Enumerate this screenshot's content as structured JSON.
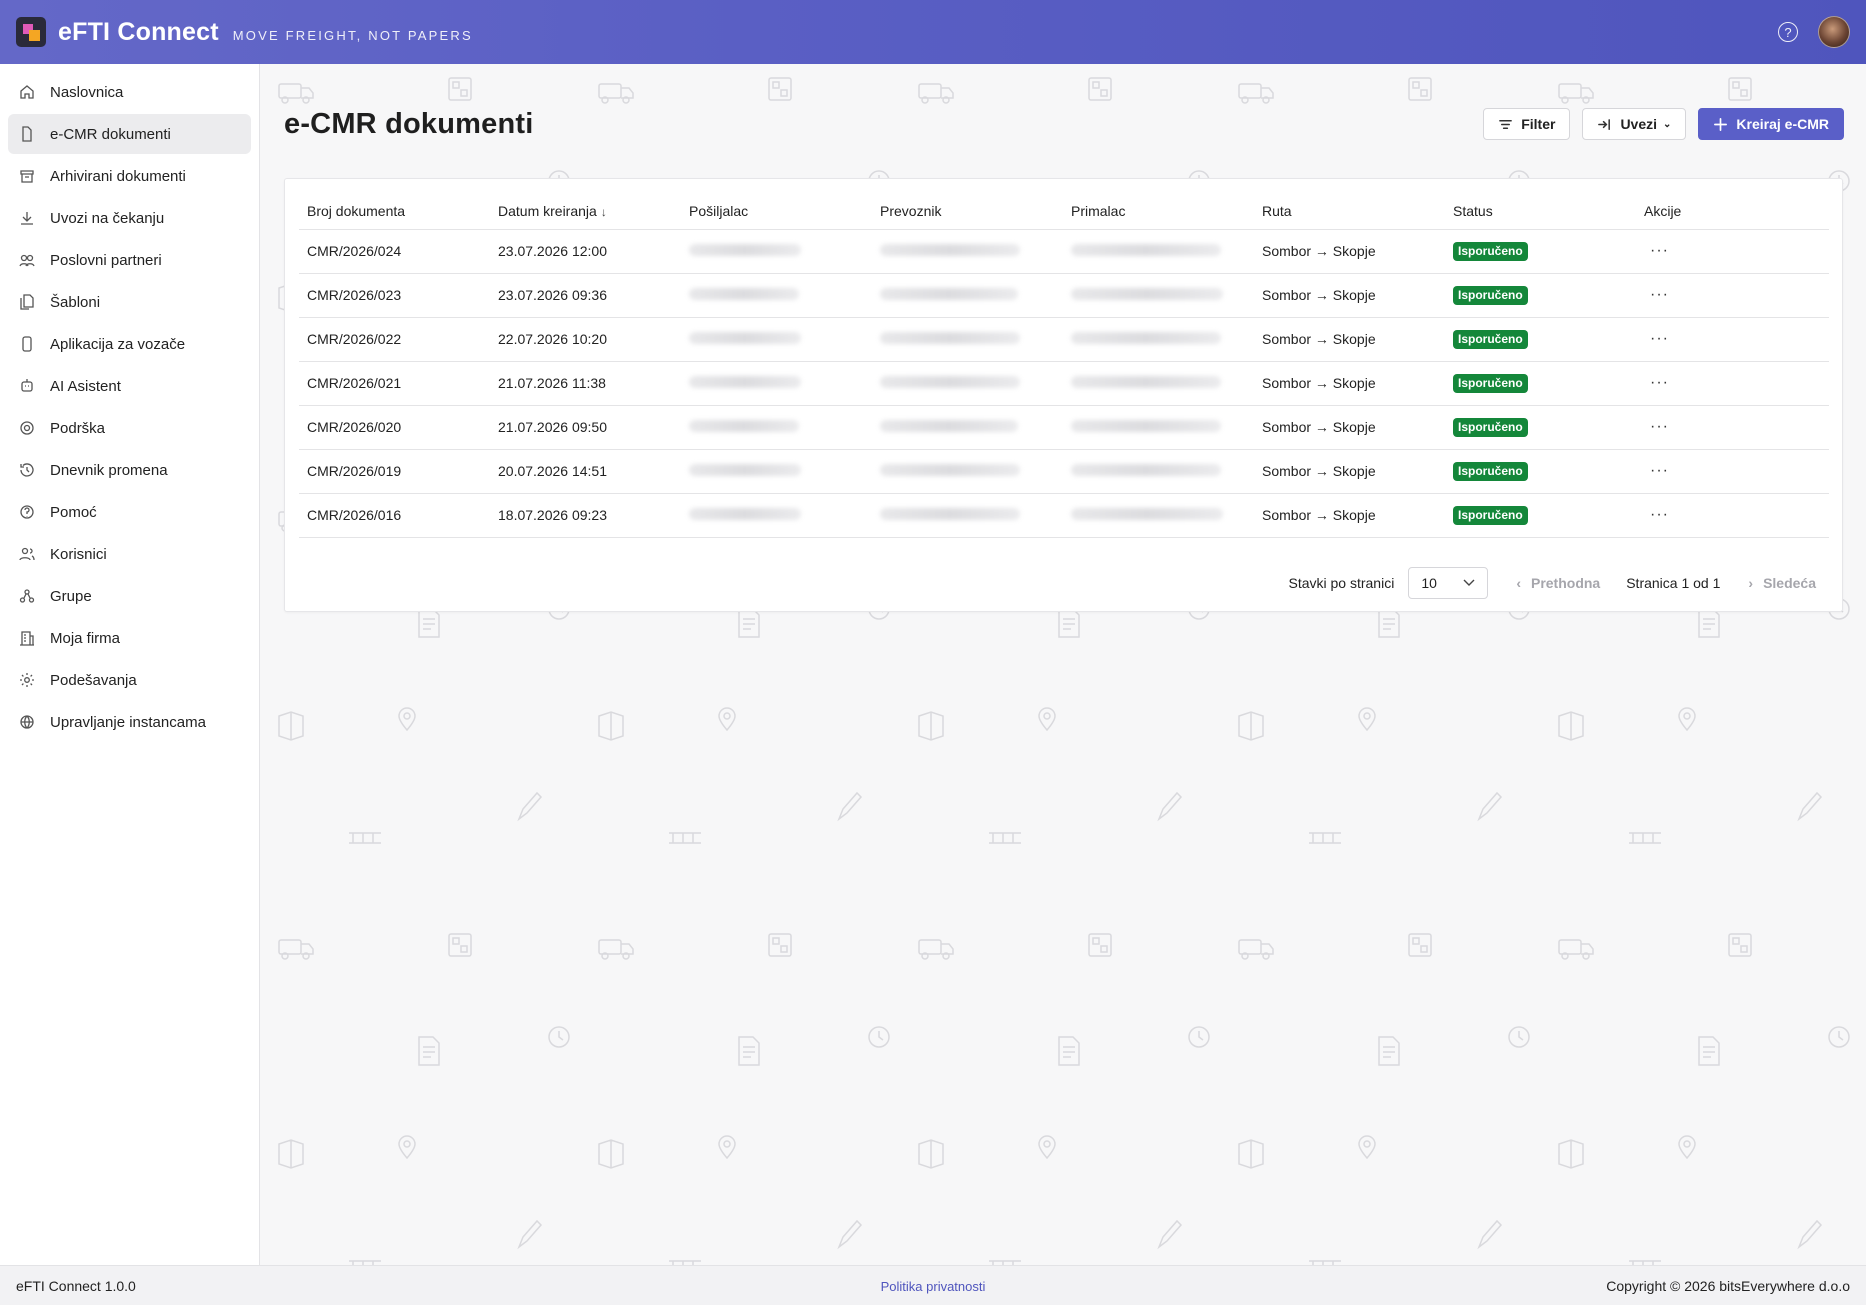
{
  "header": {
    "app_name": "eFTI Connect",
    "tagline": "MOVE FREIGHT, NOT PAPERS",
    "gradient_start": "#6468c8",
    "gradient_end": "#4f55bd"
  },
  "sidebar": {
    "items": [
      {
        "label": "Naslovnica",
        "icon": "home-icon"
      },
      {
        "label": "e-CMR dokumenti",
        "icon": "document-icon",
        "active": true
      },
      {
        "label": "Arhivirani dokumenti",
        "icon": "archive-icon"
      },
      {
        "label": "Uvozi na čekanju",
        "icon": "download-icon"
      },
      {
        "label": "Poslovni partneri",
        "icon": "partners-icon"
      },
      {
        "label": "Šabloni",
        "icon": "templates-icon"
      },
      {
        "label": "Aplikacija za vozače",
        "icon": "phone-icon"
      },
      {
        "label": "AI Asistent",
        "icon": "bot-icon"
      },
      {
        "label": "Podrška",
        "icon": "support-icon"
      },
      {
        "label": "Dnevnik promena",
        "icon": "history-icon"
      },
      {
        "label": "Pomoć",
        "icon": "help-icon"
      },
      {
        "label": "Korisnici",
        "icon": "users-icon"
      },
      {
        "label": "Grupe",
        "icon": "groups-icon"
      },
      {
        "label": "Moja firma",
        "icon": "building-icon"
      },
      {
        "label": "Podešavanja",
        "icon": "gear-icon"
      },
      {
        "label": "Upravljanje instancama",
        "icon": "globe-icon"
      }
    ]
  },
  "main": {
    "title": "e-CMR dokumenti",
    "toolbar": {
      "filter_label": "Filter",
      "import_label": "Uvezi",
      "create_label": "Kreiraj e-CMR",
      "accent": "#5a5fc8"
    },
    "table": {
      "columns": [
        "Broj dokumenta",
        "Datum kreiranja",
        "Pošiljalac",
        "Prevoznik",
        "Primalac",
        "Ruta",
        "Status",
        "Akcije"
      ],
      "rows": [
        {
          "number": "CMR/2026/024",
          "date": "23.07.2026 12:00",
          "route": "Sombor → Skopje",
          "status": "Isporučeno"
        },
        {
          "number": "CMR/2026/023",
          "date": "23.07.2026 09:36",
          "route": "Sombor → Skopje",
          "status": "Isporučeno"
        },
        {
          "number": "CMR/2026/022",
          "date": "22.07.2026 10:20",
          "route": "Sombor → Skopje",
          "status": "Isporučeno"
        },
        {
          "number": "CMR/2026/021",
          "date": "21.07.2026 11:38",
          "route": "Sombor → Skopje",
          "status": "Isporučeno"
        },
        {
          "number": "CMR/2026/020",
          "date": "21.07.2026 09:50",
          "route": "Sombor → Skopje",
          "status": "Isporučeno"
        },
        {
          "number": "CMR/2026/019",
          "date": "20.07.2026 14:51",
          "route": "Sombor → Skopje",
          "status": "Isporučeno"
        },
        {
          "number": "CMR/2026/016",
          "date": "18.07.2026 09:23",
          "route": "Sombor → Skopje",
          "status": "Isporučeno"
        }
      ],
      "status_color": "#14873a"
    },
    "pagination": {
      "per_page_label": "Stavki po stranici",
      "per_page_value": "10",
      "prev_label": "Prethodna",
      "page_info": "Stranica 1 od 1",
      "next_label": "Sledeća"
    }
  },
  "footer": {
    "version": "eFTI Connect 1.0.0",
    "privacy": "Politika privatnosti",
    "copyright": "Copyright © 2026 bitsEverywhere d.o.o"
  }
}
